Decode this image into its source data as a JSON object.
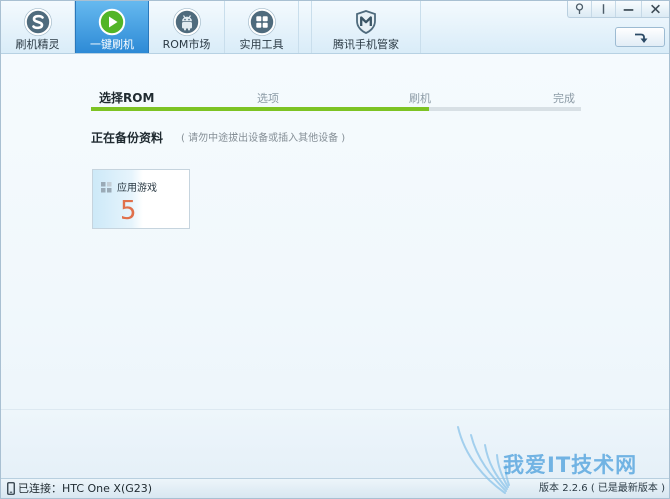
{
  "header": {
    "tabs": [
      {
        "label": "刷机精灵",
        "icon": "shuaji-sprite-logo-icon",
        "active": false
      },
      {
        "label": "一键刷机",
        "icon": "play-icon",
        "active": true
      },
      {
        "label": "ROM市场",
        "icon": "android-icon",
        "active": false
      },
      {
        "label": "实用工具",
        "icon": "tools-grid-icon",
        "active": false
      },
      {
        "label": "腾讯手机管家",
        "icon": "tencent-shield-icon",
        "active": false
      }
    ],
    "window_controls": [
      {
        "icon": "feedback-icon"
      },
      {
        "icon": "menu-icon"
      },
      {
        "icon": "minimize-icon"
      },
      {
        "icon": "close-icon"
      }
    ],
    "action_button_icon": "curved-arrow-down-icon"
  },
  "steps": {
    "items": [
      {
        "label": "选择ROM",
        "active": true
      },
      {
        "label": "选项",
        "active": false
      },
      {
        "label": "刷机",
        "active": false
      },
      {
        "label": "完成",
        "active": false
      }
    ],
    "progress": 0.69
  },
  "backup": {
    "title": "正在备份资料",
    "hint": "( 请勿中途拔出设备或插入其他设备 )",
    "cards": [
      {
        "label": "应用游戏",
        "count": 5,
        "icon": "apps-grid-icon"
      }
    ]
  },
  "status_bar": {
    "phone_icon": "phone-icon",
    "connection": "已连接：HTC One X(G23)",
    "version": "版本 2.2.6 ( 已是最新版本 )"
  },
  "watermark": {
    "logo": "wing-logo",
    "text": "我爱IT技术网"
  },
  "colors": {
    "accent": "#2d8ad6",
    "progress_done": "#7dc324",
    "progress_track": "#d8e0e5",
    "count": "#e0704b"
  }
}
